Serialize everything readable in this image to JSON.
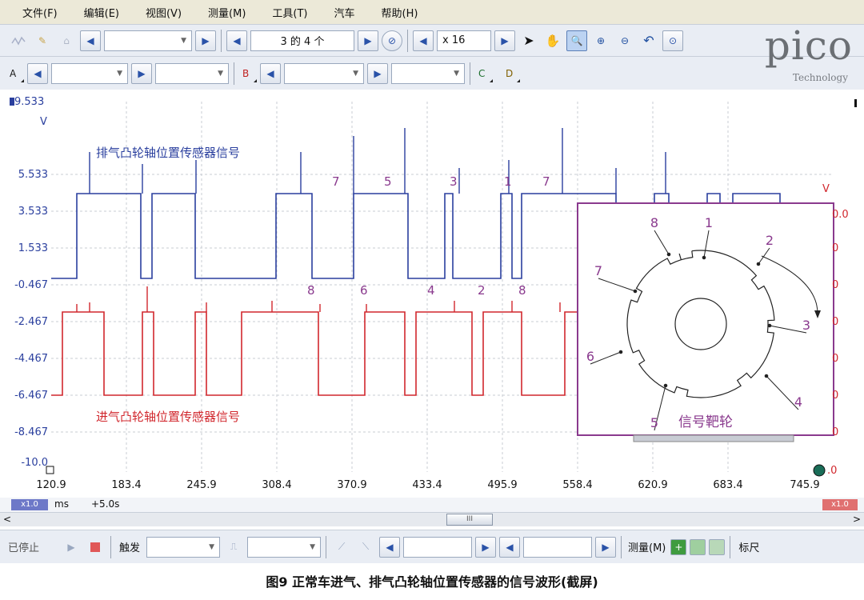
{
  "menu": [
    "文件(F)",
    "编辑(E)",
    "视图(V)",
    "测量(M)",
    "工具(T)",
    "汽车",
    "帮助(H)"
  ],
  "toolbar": {
    "page_indicator": "3 的 4 个",
    "zoom_value": "x 16"
  },
  "channels": {
    "a": "A",
    "b": "B",
    "c": "C",
    "d": "D"
  },
  "logo": {
    "brand": "pico",
    "sub": "Technology"
  },
  "plot": {
    "y_unit": "V",
    "right_unit": "V",
    "y_ticks": [
      "9.533",
      "5.533",
      "3.533",
      "1.533",
      "-0.467",
      "-2.467",
      "-4.467",
      "-6.467",
      "-8.467",
      "-10.0"
    ],
    "right_ticks": [
      "0.0",
      "0",
      "0",
      "0",
      "0",
      "0",
      "0",
      ".0",
      "4.0"
    ],
    "x_ticks": [
      "120.9",
      "183.4",
      "245.9",
      "308.4",
      "370.9",
      "433.4",
      "495.9",
      "558.4",
      "620.9",
      "683.4",
      "745.9"
    ],
    "x_unit": "ms",
    "timebase_offset": "+5.0s",
    "zoom_left": "x1.0",
    "zoom_right": "x1.0",
    "exhaust_label": "排气凸轮轴位置传感器信号",
    "intake_label": "进气凸轮轴位置传感器信号",
    "top_tooth_labels": [
      "7",
      "5",
      "3",
      "1",
      "7"
    ],
    "bottom_tooth_labels": [
      "8",
      "6",
      "4",
      "2",
      "8"
    ],
    "colors": {
      "exhaust": "#2a3f9e",
      "intake": "#d1272d",
      "inset_border": "#8a3a8e",
      "label": "#8a3a8e"
    }
  },
  "inset": {
    "title": "信号靶轮",
    "tooth_numbers": [
      "1",
      "2",
      "3",
      "4",
      "5",
      "6",
      "7",
      "8"
    ]
  },
  "status": {
    "stopped": "已停止",
    "trigger": "触发",
    "measure": "测量(M)",
    "ruler": "标尺"
  },
  "scroll_thumb": "III",
  "caption": "图9   正常车进气、排气凸轮轴位置传感器的信号波形(截屏)"
}
